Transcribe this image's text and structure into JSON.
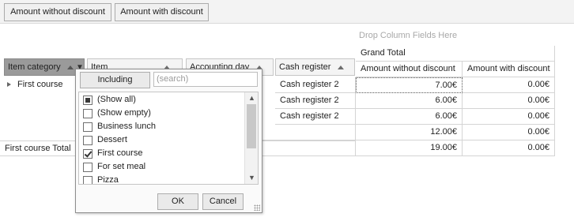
{
  "toolbar": {
    "amount_without_discount": "Amount without discount",
    "amount_with_discount": "Amount with discount"
  },
  "pivot": {
    "column_drop_hint": "Drop Column Fields Here",
    "row_fields": [
      "Item category",
      "Item",
      "Accounting day",
      "Cash register"
    ],
    "grand_total_label": "Grand Total",
    "data_headers": [
      "Amount without discount",
      "Amount with discount"
    ],
    "row_group_label": "First course",
    "rows": [
      {
        "cash_register": "Cash register 2",
        "without": "7.00€",
        "with": "0.00€"
      },
      {
        "cash_register": "Cash register 2",
        "without": "6.00€",
        "with": "0.00€"
      },
      {
        "cash_register": "Cash register 2",
        "without": "6.00€",
        "with": "0.00€"
      }
    ],
    "subtotal": {
      "without": "12.00€",
      "with": "0.00€"
    },
    "group_total_label": "First course Total",
    "group_total": {
      "without": "19.00€",
      "with": "0.00€"
    }
  },
  "filter_popup": {
    "including_label": "Including",
    "search_placeholder": "(search)",
    "items": [
      {
        "label": "(Show all)",
        "state": "partial"
      },
      {
        "label": "(Show empty)",
        "state": "unchecked"
      },
      {
        "label": "Business lunch",
        "state": "unchecked"
      },
      {
        "label": "Dessert",
        "state": "unchecked"
      },
      {
        "label": "First course",
        "state": "checked"
      },
      {
        "label": "For set meal",
        "state": "unchecked"
      },
      {
        "label": "Pizza",
        "state": "unchecked"
      }
    ],
    "ok_label": "OK",
    "cancel_label": "Cancel"
  }
}
